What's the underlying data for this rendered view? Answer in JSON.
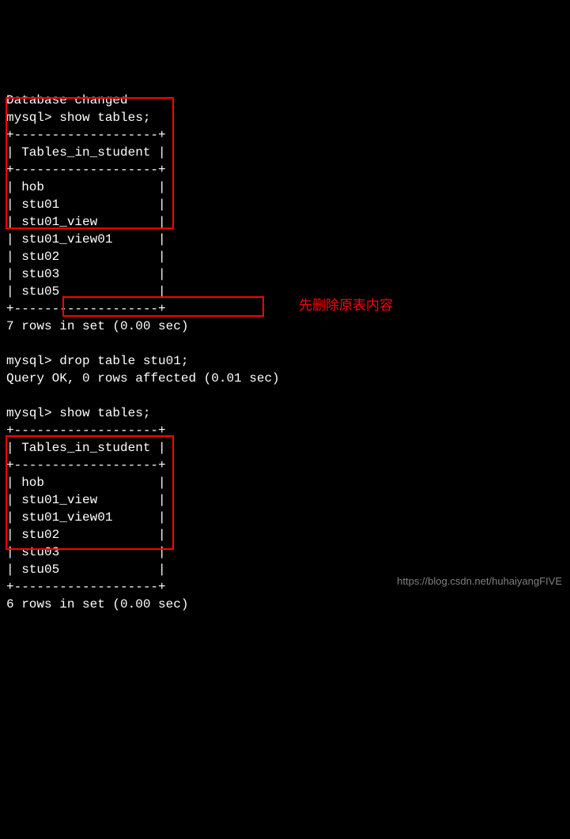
{
  "terminal": {
    "l01": "Database changed",
    "l02": "mysql> show tables;",
    "l03": "+-------------------+",
    "l04": "| Tables_in_student |",
    "l05": "+-------------------+",
    "l06": "| hob               |",
    "l07": "| stu01             |",
    "l08": "| stu01_view        |",
    "l09": "| stu01_view01      |",
    "l10": "| stu02             |",
    "l11": "| stu03             |",
    "l12": "| stu05             |",
    "l13": "+-------------------+",
    "l14": "7 rows in set (0.00 sec)",
    "l15": "",
    "l16": "mysql> drop table stu01;",
    "l17": "Query OK, 0 rows affected (0.01 sec)",
    "l18": "",
    "l19": "mysql> show tables;",
    "l20": "+-------------------+",
    "l21": "| Tables_in_student |",
    "l22": "+-------------------+",
    "l23": "| hob               |",
    "l24": "| stu01_view        |",
    "l25": "| stu01_view01      |",
    "l26": "| stu02             |",
    "l27": "| stu03             |",
    "l28": "| stu05             |",
    "l29": "+-------------------+",
    "l30": "6 rows in set (0.00 sec)"
  },
  "tables_first": [
    "hob",
    "stu01",
    "stu01_view",
    "stu01_view01",
    "stu02",
    "stu03",
    "stu05"
  ],
  "tables_second": [
    "hob",
    "stu01_view",
    "stu01_view01",
    "stu02",
    "stu03",
    "stu05"
  ],
  "annotation_text": "先删除原表内容",
  "watermark_text": "https://blog.csdn.net/huhaiyangFIVE",
  "colors": {
    "background": "#000000",
    "foreground": "#ffffff",
    "highlight": "#ff0000"
  }
}
